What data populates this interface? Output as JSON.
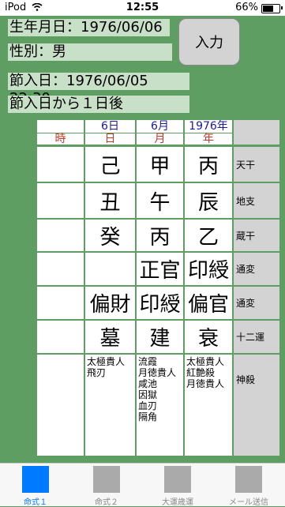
{
  "status_bar": {
    "carrier": "iPod",
    "time": "12:55",
    "battery": "66%",
    "battery_level": 0.66
  },
  "birth_date": "生年月日：1976/06/06",
  "gender": "性別：男",
  "input_button": "入力",
  "setsuiri_date": "節入日：1976/06/05 22:30",
  "setsuiri_after": "節入日から１日後",
  "headers": {
    "day_num": "6日",
    "month_num": "6月",
    "year_num": "1976年",
    "hour": "時",
    "day": "日",
    "month": "月",
    "year": "年"
  },
  "rows": [
    {
      "label": "天干",
      "cells": [
        "",
        "己",
        "甲",
        "丙"
      ]
    },
    {
      "label": "地支",
      "cells": [
        "",
        "丑",
        "午",
        "辰"
      ]
    },
    {
      "label": "蔵干",
      "cells": [
        "",
        "癸",
        "丙",
        "乙"
      ]
    },
    {
      "label": "通変",
      "cells": [
        "",
        "",
        "正官",
        "印綬"
      ]
    },
    {
      "label": "通変",
      "cells": [
        "",
        "偏財",
        "印綬",
        "偏官"
      ]
    },
    {
      "label": "十二運",
      "cells": [
        "",
        "墓",
        "建",
        "衰"
      ]
    },
    {
      "label": "神殺",
      "cells": [
        "",
        "太極貴人\n飛刃",
        "流霞\n月徳貴人\n咸池\n因獄\n血刃\n隔角",
        "太極貴人\n紅艶殺\n月徳貴人"
      ]
    }
  ],
  "tabs": [
    {
      "label": "命式１",
      "active": true
    },
    {
      "label": "命式２",
      "active": false
    },
    {
      "label": "大運歳運",
      "active": false
    },
    {
      "label": "メール送信",
      "active": false
    }
  ],
  "colors": {
    "background": "#5f9e62",
    "field": "#c8e0c8",
    "accent": "#007aff"
  }
}
